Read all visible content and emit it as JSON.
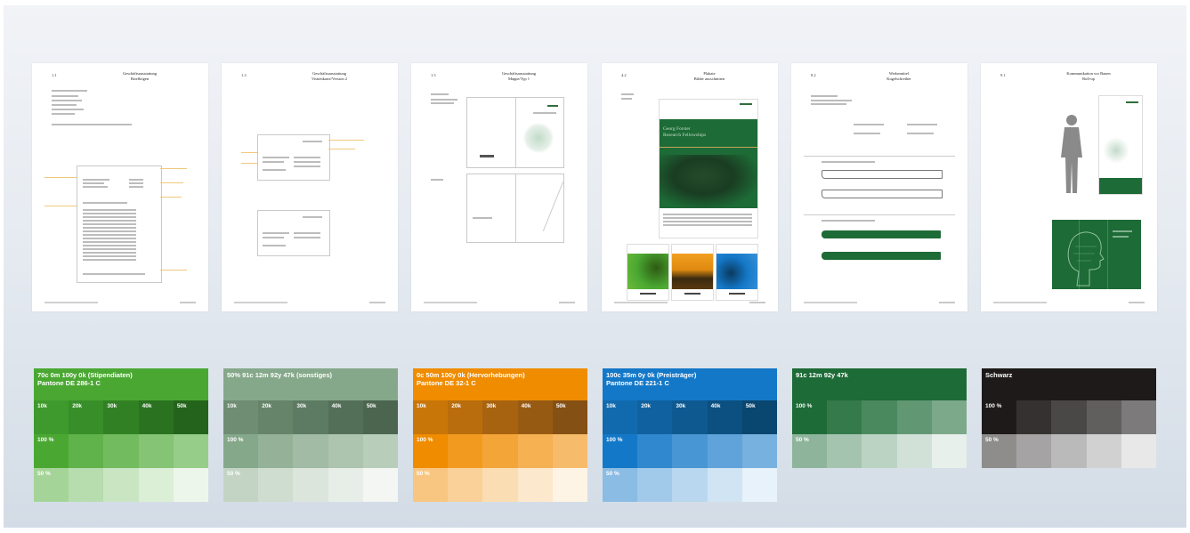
{
  "pages": [
    {
      "num": "1.1",
      "title_line1": "Geschäftsausstattung",
      "title_line2": "Briefbögen"
    },
    {
      "num": "1.3",
      "title_line1": "Geschäftsausstattung",
      "title_line2": "Visitenkarte/Version 2"
    },
    {
      "num": "1.5",
      "title_line1": "Geschäftsausstattung",
      "title_line2": "Mappe/Typ 1"
    },
    {
      "num": "4.2",
      "title_line1": "Plakate",
      "title_line2": "Bilder ausschnitten"
    },
    {
      "num": "8.2",
      "title_line1": "Werbemittel",
      "title_line2": "Kugelschreiber"
    },
    {
      "num": "9.1",
      "title_line1": "Kommunikation vor Bauen",
      "title_line2": "Roll-up"
    }
  ],
  "poster": {
    "line1": "Georg Forster",
    "line2": "Research Fellowships"
  },
  "swatches": [
    {
      "header1": "70c 0m 100y 0k (Stipendiaten)",
      "header2": "Pantone DE 286-1 C",
      "tints": [
        "10k",
        "20k",
        "30k",
        "40k",
        "50k"
      ],
      "full_label": "100 %",
      "half_label": "50 %",
      "base": "#4aa832",
      "dark_row": [
        "#3e9a2c",
        "#388f29",
        "#318124",
        "#2a7220",
        "#23631b"
      ]
    },
    {
      "header1": "50% 91c 12m 92y 47k (sonstiges)",
      "header2": "",
      "tints": [
        "10k",
        "20k",
        "30k",
        "40k",
        "50k"
      ],
      "full_label": "100 %",
      "half_label": "50 %",
      "base": "#86a88a",
      "dark_row": [
        "#6e8d73",
        "#66846a",
        "#5d7a62",
        "#546f58",
        "#4b654e"
      ]
    },
    {
      "header1": "0c 50m 100y 0k (Hervorhebungen)",
      "header2": "Pantone DE 32-1 C",
      "tints": [
        "10k",
        "20k",
        "30k",
        "40k",
        "50k"
      ],
      "full_label": "100 %",
      "half_label": "50 %",
      "base": "#f08c00",
      "dark_row": [
        "#c97608",
        "#b96d0c",
        "#a86310",
        "#975a12",
        "#855014"
      ]
    },
    {
      "header1": "100c 35m 0y 0k (Preisträger)",
      "header2": "Pantone DE 221-1 C",
      "tints": [
        "10k",
        "20k",
        "30k",
        "40k",
        "50k"
      ],
      "full_label": "100 %",
      "half_label": "50 %",
      "base": "#1478c8",
      "dark_row": [
        "#116aae",
        "#0f629f",
        "#0d5990",
        "#0b5080",
        "#094670"
      ]
    },
    {
      "header1": "91c 12m 92y 47k",
      "header2": "",
      "full_label": "100 %",
      "half_label": "50 %",
      "base": "#1d6b36"
    },
    {
      "header1": "Schwarz",
      "header2": "",
      "full_label": "100 %",
      "half_label": "50 %",
      "base": "#1d1a19"
    }
  ]
}
